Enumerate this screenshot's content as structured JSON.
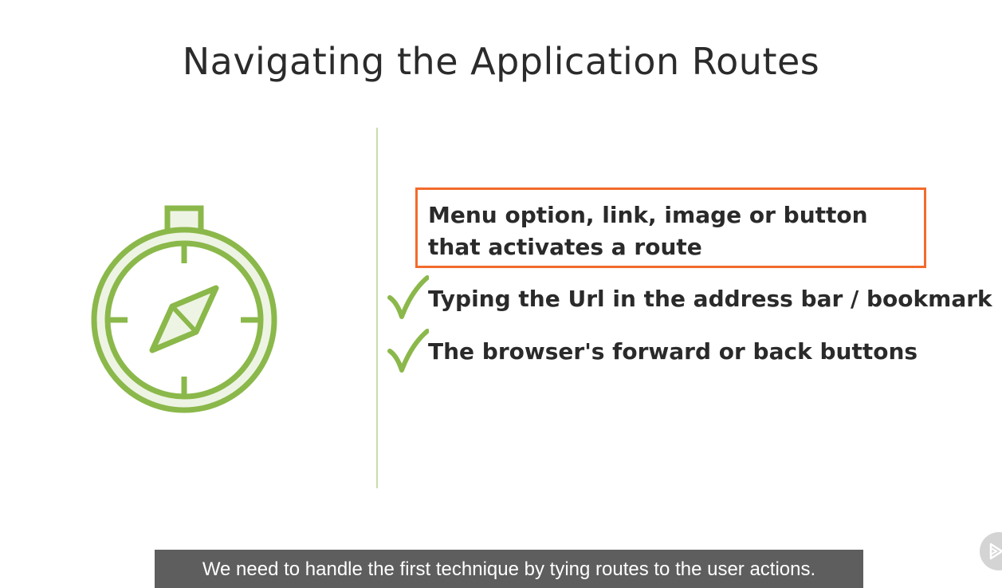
{
  "slide": {
    "title": "Navigating the Application Routes",
    "bullets": [
      "Menu option, link, image or button that activates a route",
      "Typing the Url in the address bar / bookmark",
      "The browser's forward or back buttons"
    ],
    "highlighted_bullet_index": 0,
    "checked_bullets": [
      1,
      2
    ],
    "icon": "compass-icon"
  },
  "caption": {
    "text": "We need to handle the first technique by tying routes to the user actions."
  },
  "player": {
    "button_icon": "play-next-icon"
  },
  "colors": {
    "accent_green": "#8bb84a",
    "highlight_orange": "#f26b2b",
    "divider": "#c9dcae"
  }
}
